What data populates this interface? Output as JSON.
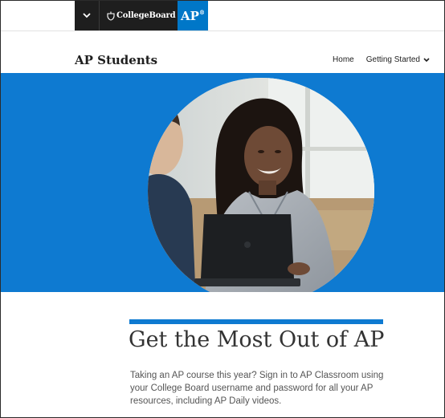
{
  "global_bar": {
    "menu_icon": "chevron-down-icon",
    "brand_logo": "CollegeBoard",
    "program_tab": "AP",
    "program_tab_mark": "®"
  },
  "site_header": {
    "title": "AP Students",
    "nav": [
      {
        "label": "Home"
      },
      {
        "label": "Getting Started",
        "icon": "chevron-down-icon"
      }
    ]
  },
  "hero": {
    "image": "student-with-laptop-photo"
  },
  "content": {
    "heading": "Get the Most Out of AP",
    "intro": "Taking an AP course this year? Sign in to AP Classroom using your College Board username and password for all your AP resources, including AP Daily videos."
  },
  "colors": {
    "accent_blue": "#0e7ad1",
    "ap_tab_blue": "#0077c8",
    "dark_bar": "#1e1e1e"
  }
}
